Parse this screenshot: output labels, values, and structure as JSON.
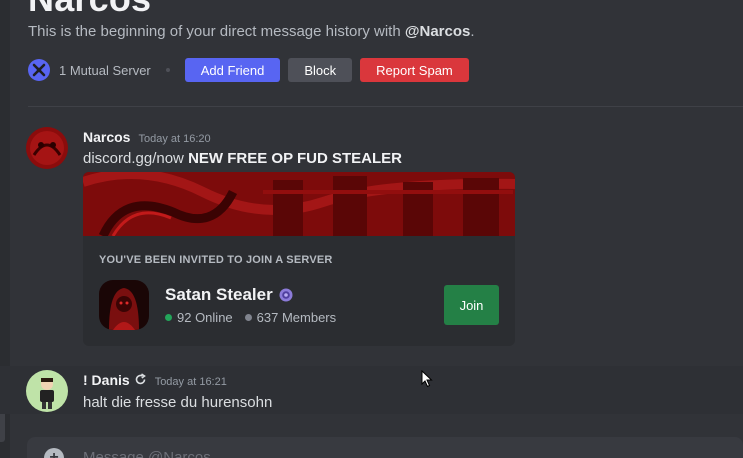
{
  "header": {
    "title": "Narcos",
    "intro_prefix": "This is the beginning of your direct message history with ",
    "intro_handle": "@Narcos",
    "intro_suffix": "."
  },
  "actions": {
    "mutual_servers": "1 Mutual Server",
    "add_friend": "Add Friend",
    "block": "Block",
    "report_spam": "Report Spam"
  },
  "messages": [
    {
      "username": "Narcos",
      "timestamp": "Today at 16:20",
      "text_plain": "discord.gg/now ",
      "text_bold": "NEW FREE OP FUD STEALER"
    },
    {
      "username": "! Danis",
      "timestamp": "Today at 16:21",
      "text": "halt die fresse du hurensohn"
    }
  ],
  "invite": {
    "heading": "YOU'VE BEEN INVITED TO JOIN A SERVER",
    "server_name": "Satan Stealer",
    "online": "92 Online",
    "members": "637 Members",
    "join": "Join"
  },
  "composer": {
    "placeholder": "Message @Narcos"
  },
  "colors": {
    "blurple": "#5865f2",
    "danger": "#da373c",
    "success": "#248046",
    "online": "#23a55a"
  }
}
